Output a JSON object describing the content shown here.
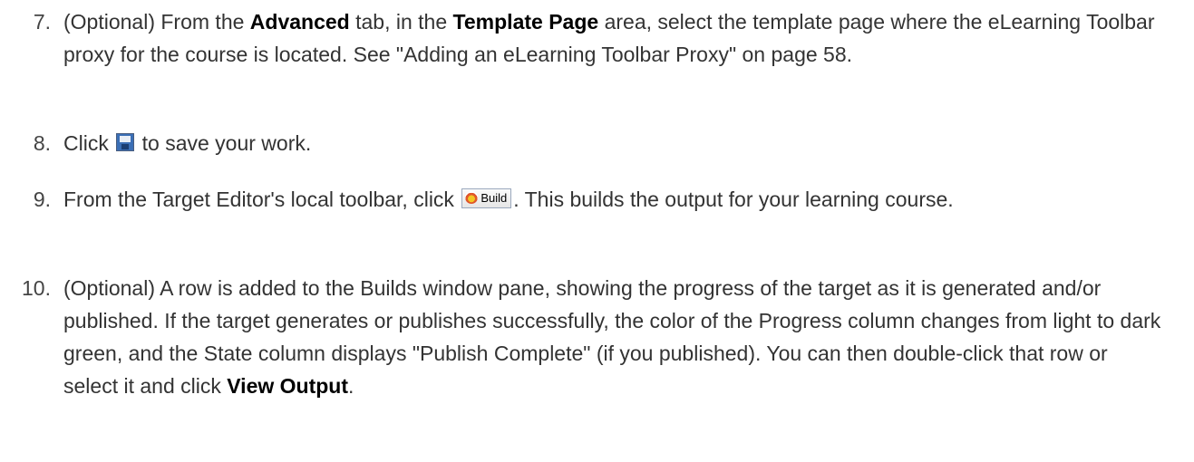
{
  "steps": [
    {
      "number": "7.",
      "t1": "(Optional) From the ",
      "b1": "Advanced",
      "t2": " tab, in the ",
      "b2": "Template Page",
      "t3": " area, select the template page where the eLearning Toolbar proxy for the course is located. See \"Adding an eLearning Toolbar Proxy\" on page 58."
    },
    {
      "number": "8.",
      "t1": "Click ",
      "icon": "save-icon",
      "t2": " to save your work."
    },
    {
      "number": "9.",
      "t1": "From the Target Editor's local toolbar, click ",
      "button_label": "Build",
      "button_icon": "build-icon",
      "t2": ". This builds the output for your learning course."
    },
    {
      "number": "10.",
      "t1": "(Optional) A row is added to the Builds window pane, showing the progress of the target as it is generated and/or published. If the target generates or publishes successfully, the color of the Progress column changes from light to dark green, and the State column displays \"Publish Complete\" (if you published). You can then double-click that row or select it and click ",
      "b1": "View Output",
      "t2": "."
    }
  ]
}
